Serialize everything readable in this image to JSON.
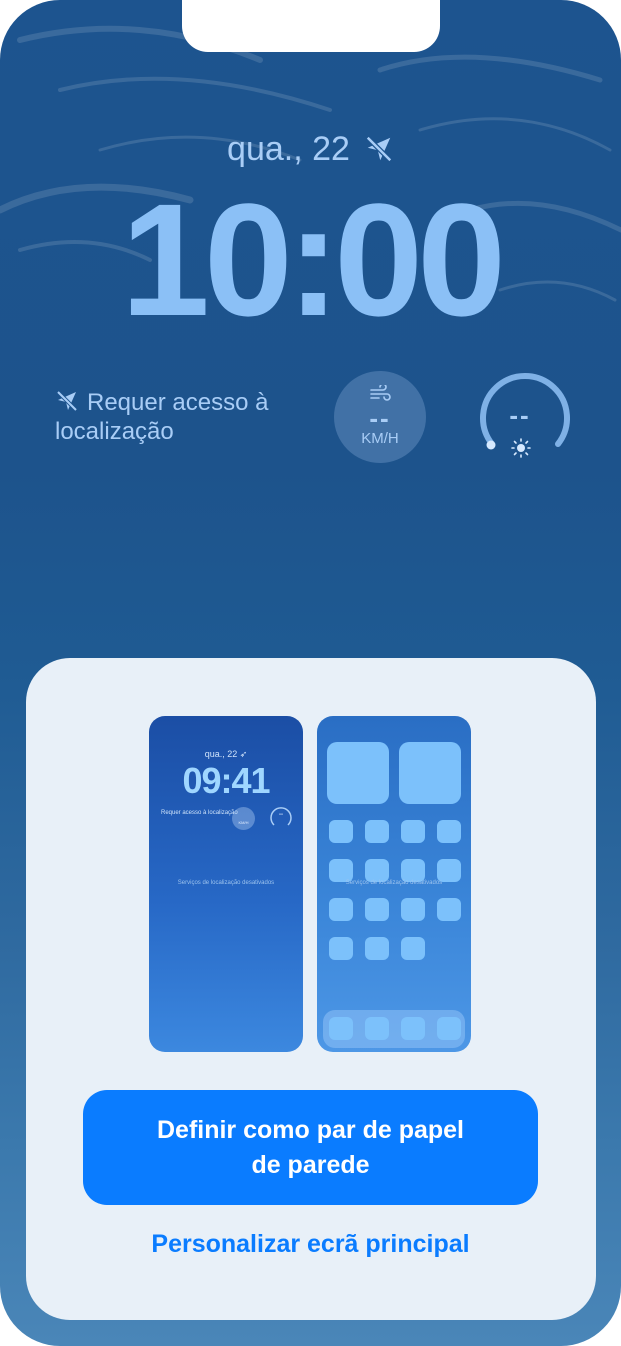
{
  "lock_screen": {
    "date": "qua., 22",
    "time": "10:00",
    "location_widget_text": "Requer acesso à localização",
    "wind_widget": {
      "value": "--",
      "unit": "KM/H"
    },
    "uv_widget": {
      "value": "--"
    }
  },
  "sheet": {
    "lock_preview": {
      "date": "qua., 22",
      "time": "09:41",
      "location_text": "Requer acesso à localização",
      "wind_unit": "KM/H",
      "gauge_value": "--",
      "services_text": "Serviços de localização desativados"
    },
    "home_preview": {
      "services_text": "Serviços de localização desativados"
    },
    "primary_button_label": "Definir como par de papel de parede",
    "secondary_link_label": "Personalizar ecrã principal"
  },
  "colors": {
    "accent": "#0a7cff",
    "sheet_background": "#e8f0f8",
    "wallpaper_top": "#1d548f",
    "clock_text": "#8bc0f6"
  },
  "icons": {
    "location_off": "location-slash-icon",
    "wind": "wind-icon",
    "uv": "sun-icon"
  }
}
